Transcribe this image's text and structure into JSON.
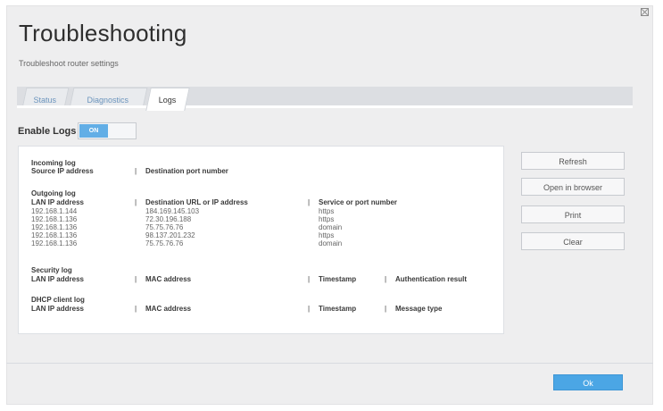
{
  "window": {
    "title": "Troubleshooting",
    "subtitle": "Troubleshoot router settings"
  },
  "tabs": [
    {
      "label": "Status",
      "active": false
    },
    {
      "label": "Diagnostics",
      "active": false
    },
    {
      "label": "Logs",
      "active": true
    }
  ],
  "enable_logs": {
    "label": "Enable Logs",
    "state": "ON"
  },
  "incoming_log": {
    "title": "Incoming log",
    "headers": [
      "Source IP address",
      "Destination port number"
    ]
  },
  "outgoing_log": {
    "title": "Outgoing log",
    "headers": [
      "LAN IP address",
      "Destination URL or IP address",
      "Service or port number"
    ],
    "rows": [
      [
        "192.168.1.144",
        "184.169.145.103",
        "https"
      ],
      [
        "192.168.1.136",
        "72.30.196.188",
        "https"
      ],
      [
        "192.168.1.136",
        "75.75.76.76",
        "domain"
      ],
      [
        "192.168.1.136",
        "98.137.201.232",
        "https"
      ],
      [
        "192.168.1.136",
        "75.75.76.76",
        "domain"
      ]
    ]
  },
  "security_log": {
    "title": "Security log",
    "headers": [
      "LAN IP address",
      "MAC address",
      "Timestamp",
      "Authentication result"
    ]
  },
  "dhcp_log": {
    "title": "DHCP client log",
    "headers": [
      "LAN IP address",
      "MAC address",
      "Timestamp",
      "Message type"
    ]
  },
  "buttons": {
    "refresh": "Refresh",
    "open_browser": "Open in browser",
    "print": "Print",
    "clear": "Clear",
    "ok": "Ok"
  },
  "separator": "|",
  "colors": {
    "accent": "#4ba6e5",
    "toggle_on": "#62aee6",
    "background": "#eeeeef"
  }
}
